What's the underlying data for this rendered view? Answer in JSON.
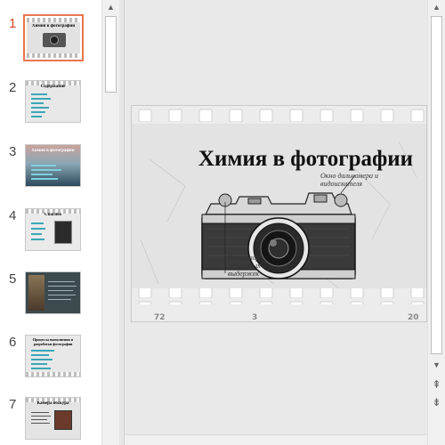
{
  "slides": [
    {
      "number": "1",
      "title": "Химия в фотографии",
      "selected": true
    },
    {
      "number": "2",
      "title": "Содержание",
      "selected": false
    },
    {
      "number": "3",
      "title": "Химия в фотографии",
      "selected": false
    },
    {
      "number": "4",
      "title": "Спасибо",
      "selected": false
    },
    {
      "number": "5",
      "title": "",
      "selected": false
    },
    {
      "number": "6",
      "title": "Процессы выполнения и разработки фотографии",
      "selected": false
    },
    {
      "number": "7",
      "title": "Камера обскура",
      "selected": false
    }
  ],
  "current_slide": {
    "title": "Химия в фотографии",
    "note_top": "Окно дальномера и видоискателя",
    "note_bottom": "Регулятор медленных выдержек"
  },
  "scroll": {
    "up_arrow": "▲",
    "down_arrow": "▼",
    "prev_slide": "⇞",
    "next_slide": "⇟"
  }
}
